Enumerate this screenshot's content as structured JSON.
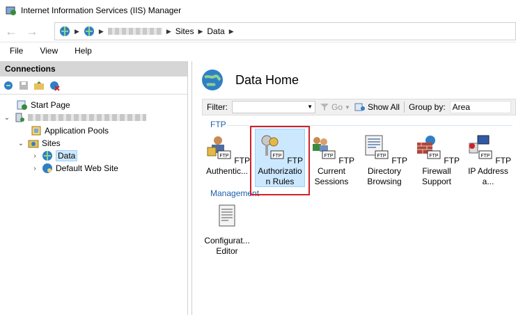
{
  "window": {
    "title": "Internet Information Services (IIS) Manager"
  },
  "address": {
    "crumbs": [
      "Sites",
      "Data"
    ]
  },
  "menu": [
    "File",
    "View",
    "Help"
  ],
  "connections": {
    "header": "Connections",
    "tree": [
      {
        "label": "Start Page"
      },
      {
        "label": "Application Pools"
      },
      {
        "label": "Sites"
      },
      {
        "label": "Data"
      },
      {
        "label": "Default Web Site"
      }
    ]
  },
  "main": {
    "title": "Data Home",
    "filter_label": "Filter:",
    "go_label": "Go",
    "showall_label": "Show All",
    "groupby_label": "Group by:",
    "groupby_value": "Area",
    "sections": [
      {
        "name": "FTP",
        "items": [
          {
            "label": "FTP Authentic..."
          },
          {
            "label": "FTP Authorizatio n Rules"
          },
          {
            "label": "FTP Current Sessions"
          },
          {
            "label": "FTP Directory Browsing"
          },
          {
            "label": "FTP Firewall Support"
          },
          {
            "label": "FTP IP Address a..."
          }
        ]
      },
      {
        "name": "Management",
        "items": [
          {
            "label": "Configurat... Editor"
          }
        ]
      }
    ]
  },
  "colors": {
    "accent": "#1f5fa8",
    "selection": "#cce8ff",
    "highlight_box": "#d0202a"
  }
}
